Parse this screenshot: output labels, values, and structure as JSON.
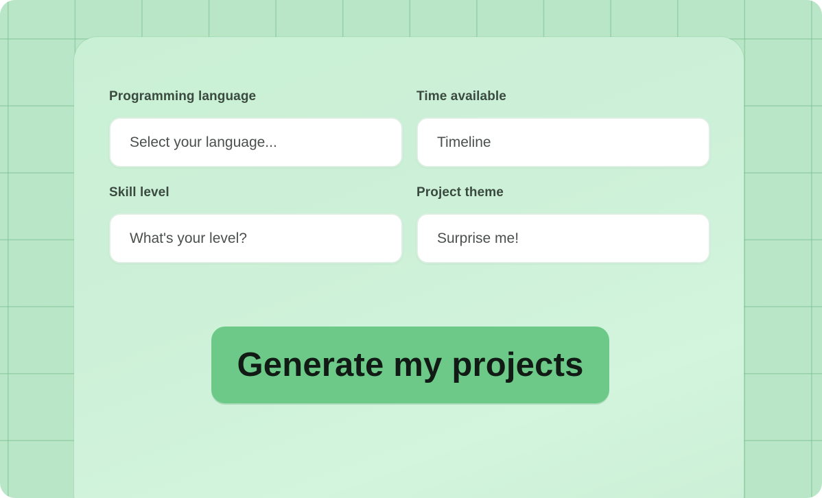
{
  "form": {
    "fields": [
      {
        "label": "Programming language",
        "placeholder": "Select your language..."
      },
      {
        "label": "Time available",
        "placeholder": "Timeline"
      },
      {
        "label": "Skill level",
        "placeholder": "What's your level?"
      },
      {
        "label": "Project theme",
        "placeholder": "Surprise me!"
      }
    ],
    "submit_label": "Generate my projects"
  },
  "colors": {
    "background": "#b8e6c6",
    "card": "#cdf1d8",
    "input": "#ffffff",
    "button": "#6cc987",
    "label_text": "#3a4a3f"
  }
}
